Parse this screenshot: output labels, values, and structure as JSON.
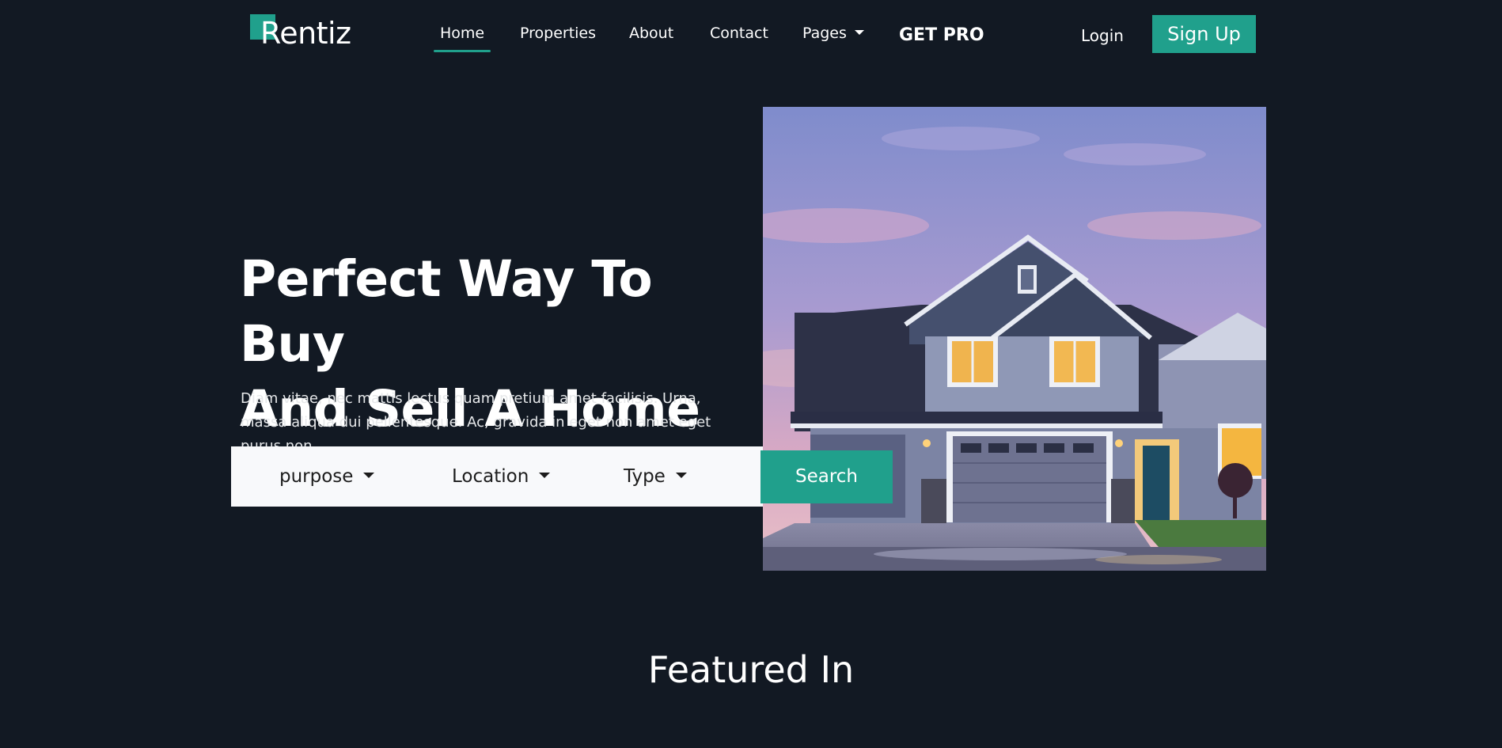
{
  "brand": {
    "name": "Rentiz",
    "accent_color": "#20a08c",
    "background_color": "#121923"
  },
  "nav": {
    "items": [
      {
        "label": "Home",
        "active": true
      },
      {
        "label": "Properties",
        "active": false
      },
      {
        "label": "About",
        "active": false
      },
      {
        "label": "Contact",
        "active": false
      },
      {
        "label": "Pages",
        "active": false,
        "has_dropdown": true
      }
    ],
    "get_pro": "GET PRO",
    "login": "Login",
    "signup": "Sign Up"
  },
  "hero": {
    "title_line1": "Perfect Way To Buy",
    "title_line2": "And Sell A Home",
    "description": "Diam vitae, nec mattis lectus quam pretium amet facilisis. Urna, massa aliqua dui pellentesque. Ac, gravida in eget non amet eget purus non.",
    "image_icon": "house-photo"
  },
  "search": {
    "filters": [
      {
        "label": "purpose"
      },
      {
        "label": "Location"
      },
      {
        "label": "Type"
      }
    ],
    "button": "Search"
  },
  "featured": {
    "title": "Featured In"
  }
}
